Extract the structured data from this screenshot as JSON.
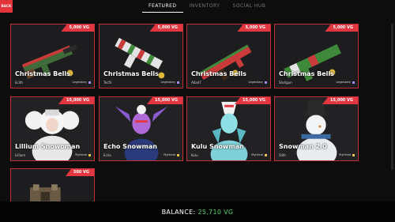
{
  "back_label": "BACK",
  "tabs": [
    "FEATURED",
    "INVENTORY",
    "SOCIAL HUB"
  ],
  "cards": [
    {
      "price": "5,000 VG",
      "name": "Christmas Bells",
      "sub": "Ecith",
      "rarity": "Legendary"
    },
    {
      "price": "5,000 VG",
      "name": "Christmas Bells",
      "sub": "Tecfil",
      "rarity": "Legendary"
    },
    {
      "price": "5,000 VG",
      "name": "Christmas Bells",
      "sub": "AKa47",
      "rarity": "Legendary"
    },
    {
      "price": "5,000 VG",
      "name": "Christmas Bells",
      "sub": "Shotgun",
      "rarity": "Legendary"
    },
    {
      "price": "15,000 VG",
      "name": "Lillium Snowoman",
      "sub": "Lillium",
      "rarity": "Mythical"
    },
    {
      "price": "15,000 VG",
      "name": "Echo Snowman",
      "sub": "Echo",
      "rarity": "Mythical"
    },
    {
      "price": "15,000 VG",
      "name": "Kulu Snowman",
      "sub": "Kulu",
      "rarity": "Mythical"
    },
    {
      "price": "15,000 VG",
      "name": "Snowman 2.0",
      "sub": "Slith",
      "rarity": "Mythical"
    },
    {
      "price": "500 VG",
      "name": "",
      "sub": "",
      "rarity": ""
    }
  ],
  "balance_label": "BALANCE:",
  "balance_value": "25,710 VG",
  "colors": {
    "accent": "#e23741",
    "balance": "#4fd66a",
    "legendary": "#a38cf0",
    "mythical": "#e8c24a"
  }
}
